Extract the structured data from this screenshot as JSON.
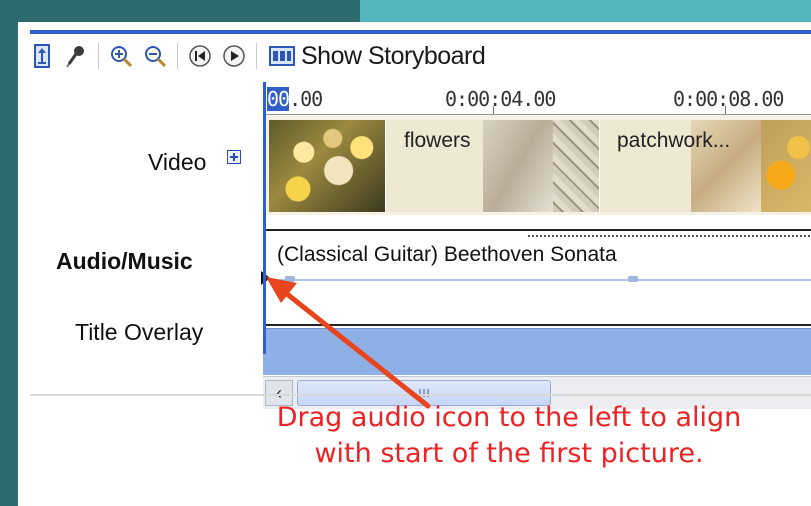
{
  "toolbar": {
    "icons": [
      "timeline-narration-icon",
      "microphone-icon",
      "zoom-in-icon",
      "zoom-out-icon",
      "rewind-icon",
      "play-icon",
      "storyboard-icon"
    ],
    "show_storyboard_label": "Show Storyboard"
  },
  "tracks": {
    "video_label": "Video",
    "audio_label": "Audio/Music",
    "title_overlay_label": "Title Overlay"
  },
  "ruler": {
    "start_prefix": "00",
    "start_suffix": ".00",
    "mark_4": "0:00:04.00",
    "mark_8": "0:00:08.00"
  },
  "video_clips": {
    "clip1": "flowers",
    "clip2": "patchwork..."
  },
  "audio_clip": {
    "label": "(Classical Guitar) Beethoven Sonata"
  },
  "annotation": {
    "line1": "Drag audio icon to the left to align",
    "line2": "with start of the first picture.",
    "color": "#ee2222"
  },
  "colors": {
    "accent_blue": "#2f5fc7",
    "title_track": "#8fb0e6",
    "background_teal": "#2f6f73"
  }
}
